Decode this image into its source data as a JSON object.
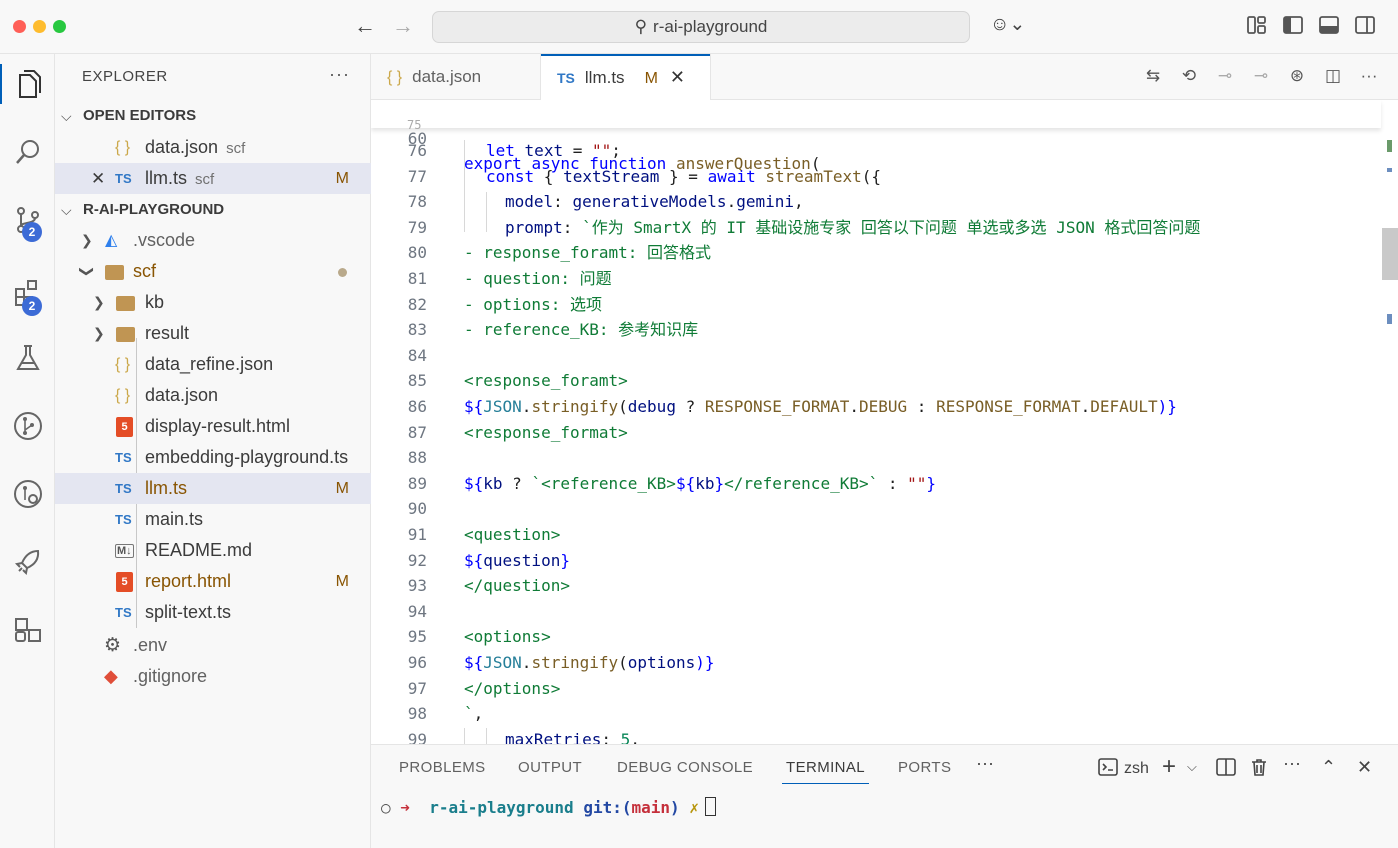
{
  "titlebar": {
    "search_text": "r-ai-playground",
    "back_icon": "arrow-left-icon",
    "forward_icon": "arrow-right-icon"
  },
  "activitybar": {
    "scm_badge": "2",
    "extensions_badge": "2"
  },
  "sidebar": {
    "title": "EXPLORER",
    "open_editors_label": "OPEN EDITORS",
    "open_editors": [
      {
        "icon": "{ }",
        "name": "data.json",
        "desc": "scf",
        "mark": ""
      },
      {
        "icon": "TS",
        "name": "llm.ts",
        "desc": "scf",
        "mark": "M"
      }
    ],
    "project_label": "R-AI-PLAYGROUND",
    "tree": [
      {
        "name": ".vscode"
      },
      {
        "name": "scf"
      },
      {
        "name": "kb"
      },
      {
        "name": "result"
      },
      {
        "name": "data_refine.json",
        "icon": "{ }"
      },
      {
        "name": "data.json",
        "icon": "{ }"
      },
      {
        "name": "display-result.html",
        "icon": "5"
      },
      {
        "name": "embedding-playground.ts",
        "icon": "TS"
      },
      {
        "name": "llm.ts",
        "icon": "TS",
        "mark": "M"
      },
      {
        "name": "main.ts",
        "icon": "TS"
      },
      {
        "name": "README.md",
        "icon": "M↓"
      },
      {
        "name": "report.html",
        "icon": "5",
        "mark": "M"
      },
      {
        "name": "split-text.ts",
        "icon": "TS"
      },
      {
        "name": ".env"
      },
      {
        "name": ".gitignore"
      }
    ]
  },
  "tabs": [
    {
      "icon": "{ }",
      "label": "data.json"
    },
    {
      "icon": "TS",
      "label": "llm.ts",
      "mark": "M"
    }
  ],
  "editor": {
    "sticky_line": "60",
    "line_numbers": [
      "76",
      "77",
      "78",
      "79",
      "80",
      "81",
      "82",
      "83",
      "84",
      "85",
      "86",
      "87",
      "88",
      "89",
      "90",
      "91",
      "92",
      "93",
      "94",
      "95",
      "96",
      "97",
      "98",
      "99"
    ],
    "sticky_partial_number": "75"
  },
  "code": {
    "l60_export": "export",
    "l60_async": "async",
    "l60_function": "function",
    "l60_name": "answerQuestion",
    "l60_paren": "(",
    "l76_let": "let",
    "l76_var": "text",
    "l76_eq": " = ",
    "l76_str": "\"\"",
    "l76_semi": ";",
    "l77_const": "const",
    "l77_open": " { ",
    "l77_var": "textStream",
    "l77_close": " } = ",
    "l77_await": "await",
    "l77_fn": "streamText",
    "l77_tail": "({",
    "l78_key": "model",
    "l78_colon": ": ",
    "l78_obj": "generativeModels",
    "l78_dot": ".",
    "l78_prop": "gemini",
    "l78_comma": ",",
    "l79_key": "prompt",
    "l79_colon": ": ",
    "l79_str": "`作为 SmartX 的 IT 基础设施专家 回答以下问题 单选或多选 JSON 格式回答问题",
    "l80": "- response_foramt: 回答格式",
    "l81": "- question: 问题",
    "l82": "- options: 选项",
    "l83": "- reference_KB: 参考知识库",
    "l85": "<response_foramt>",
    "l86_open": "${",
    "l86_json": "JSON",
    "l86_dot": ".",
    "l86_fn": "stringify",
    "l86_paren": "(",
    "l86_var": "debug",
    "l86_q": " ? ",
    "l86_c1": "RESPONSE_FORMAT",
    "l86_d1": ".",
    "l86_p1": "DEBUG",
    "l86_colon": " : ",
    "l86_c2": "RESPONSE_FORMAT",
    "l86_d2": ".",
    "l86_p2": "DEFAULT",
    "l86_close": ")}",
    "l87": "<response_format>",
    "l89_open": "${",
    "l89_var": "kb",
    "l89_q": " ? ",
    "l89_str1": "`<reference_KB>",
    "l89_in_open": "${",
    "l89_in_var": "kb",
    "l89_in_close": "}",
    "l89_str2": "</reference_KB>`",
    "l89_colon": " : ",
    "l89_empty": "\"\"",
    "l89_close": "}",
    "l91": "<question>",
    "l92_open": "${",
    "l92_var": "question",
    "l92_close": "}",
    "l93": "</question>",
    "l95": "<options>",
    "l96_open": "${",
    "l96_json": "JSON",
    "l96_dot": ".",
    "l96_fn": "stringify",
    "l96_paren": "(",
    "l96_var": "options",
    "l96_close": ")}",
    "l97": "</options>",
    "l98_tick": "`",
    "l98_comma": ",",
    "l99_key": "maxRetries",
    "l99_colon": ": ",
    "l99_num": "5",
    "l99_comma": ","
  },
  "panel": {
    "tabs": [
      "PROBLEMS",
      "OUTPUT",
      "DEBUG CONSOLE",
      "TERMINAL",
      "PORTS"
    ],
    "active_tab": "TERMINAL",
    "shell_name": "zsh",
    "terminal": {
      "circle": "○",
      "arrow": "➜",
      "dir": "r-ai-playground",
      "git": "git:(",
      "branch": "main",
      "git_close": ")",
      "x": "✗"
    }
  },
  "colors": {
    "accent": "#005fb8",
    "badge": "#3c6bd6",
    "modified": "#895503"
  }
}
